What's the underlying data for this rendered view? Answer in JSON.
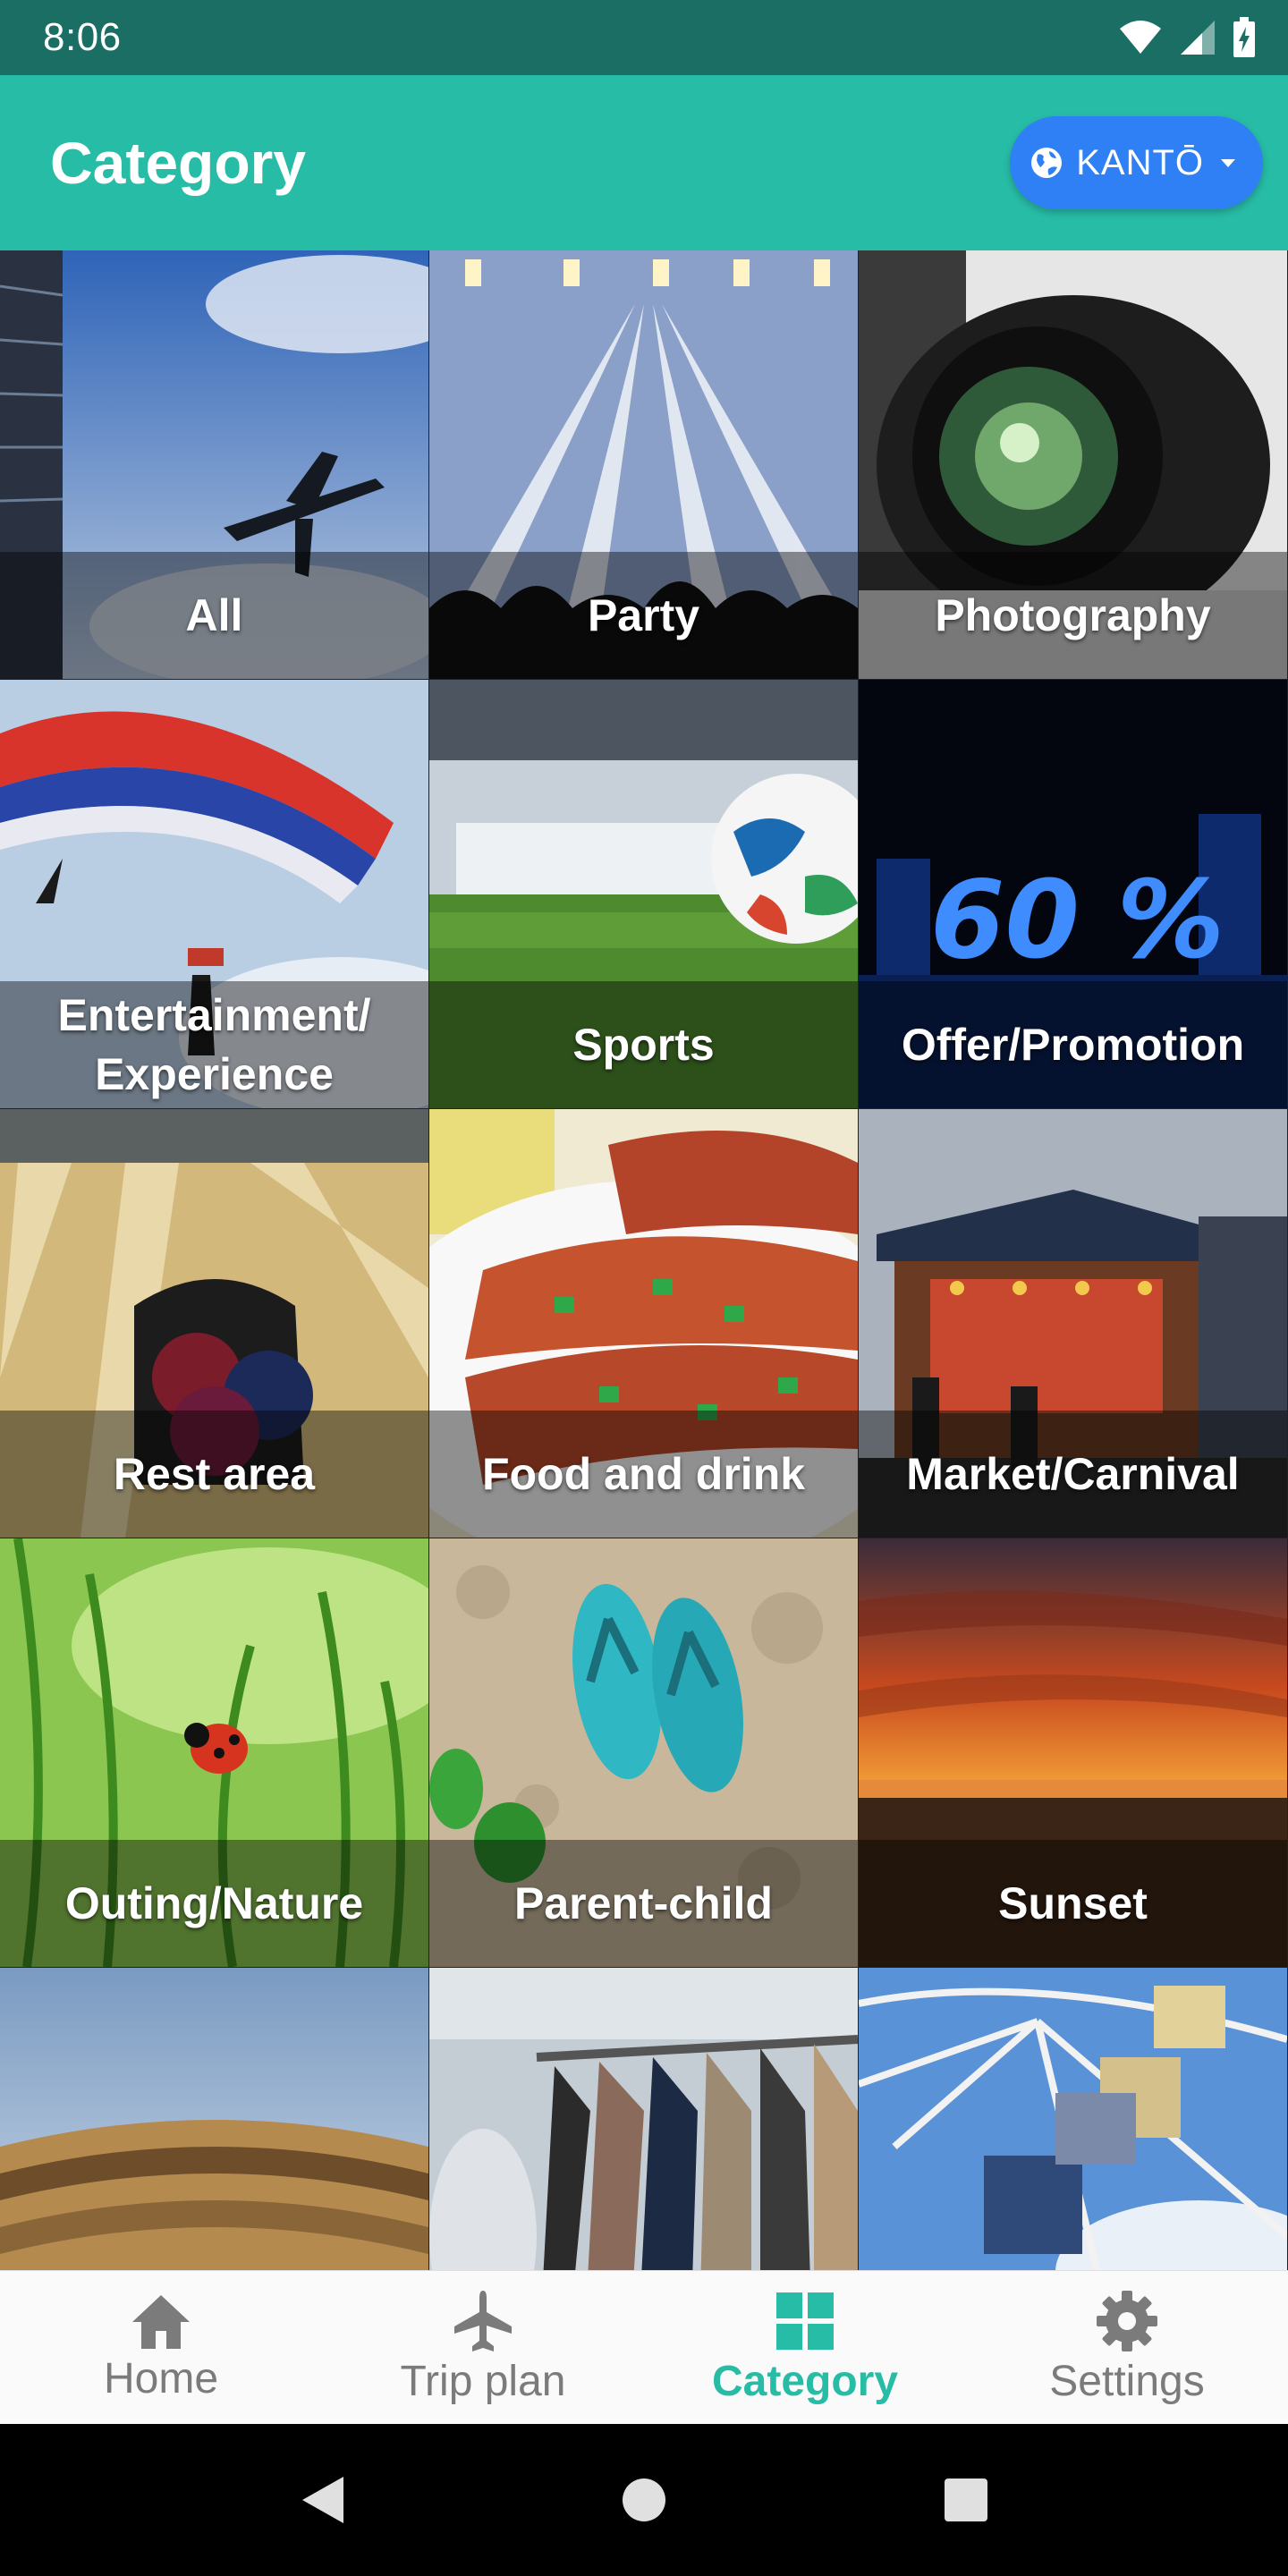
{
  "status_bar": {
    "time": "8:06"
  },
  "app_bar": {
    "title": "Category",
    "region_label": "KANTŌ"
  },
  "categories": [
    {
      "label": "All"
    },
    {
      "label": "Party"
    },
    {
      "label": "Photography"
    },
    {
      "label": "Entertainment/ Experience"
    },
    {
      "label": "Sports"
    },
    {
      "label": "Offer/Promotion"
    },
    {
      "label": "Rest area"
    },
    {
      "label": "Food and drink"
    },
    {
      "label": "Market/Carnival"
    },
    {
      "label": "Outing/Nature"
    },
    {
      "label": "Parent-child"
    },
    {
      "label": "Sunset"
    },
    {
      "label": ""
    },
    {
      "label": ""
    },
    {
      "label": ""
    }
  ],
  "offer_image_text": "60 %",
  "bottom_nav": {
    "items": [
      {
        "label": "Home",
        "icon": "home-icon"
      },
      {
        "label": "Trip plan",
        "icon": "airplane-icon"
      },
      {
        "label": "Category",
        "icon": "grid-icon"
      },
      {
        "label": "Settings",
        "icon": "gear-icon"
      }
    ],
    "active_index": 2
  },
  "colors": {
    "status_bar": "#1a6e63",
    "app_bar": "#27bca6",
    "region_button": "#2f80f5",
    "nav_active": "#27bca6",
    "nav_inactive": "#7b7b7b"
  }
}
